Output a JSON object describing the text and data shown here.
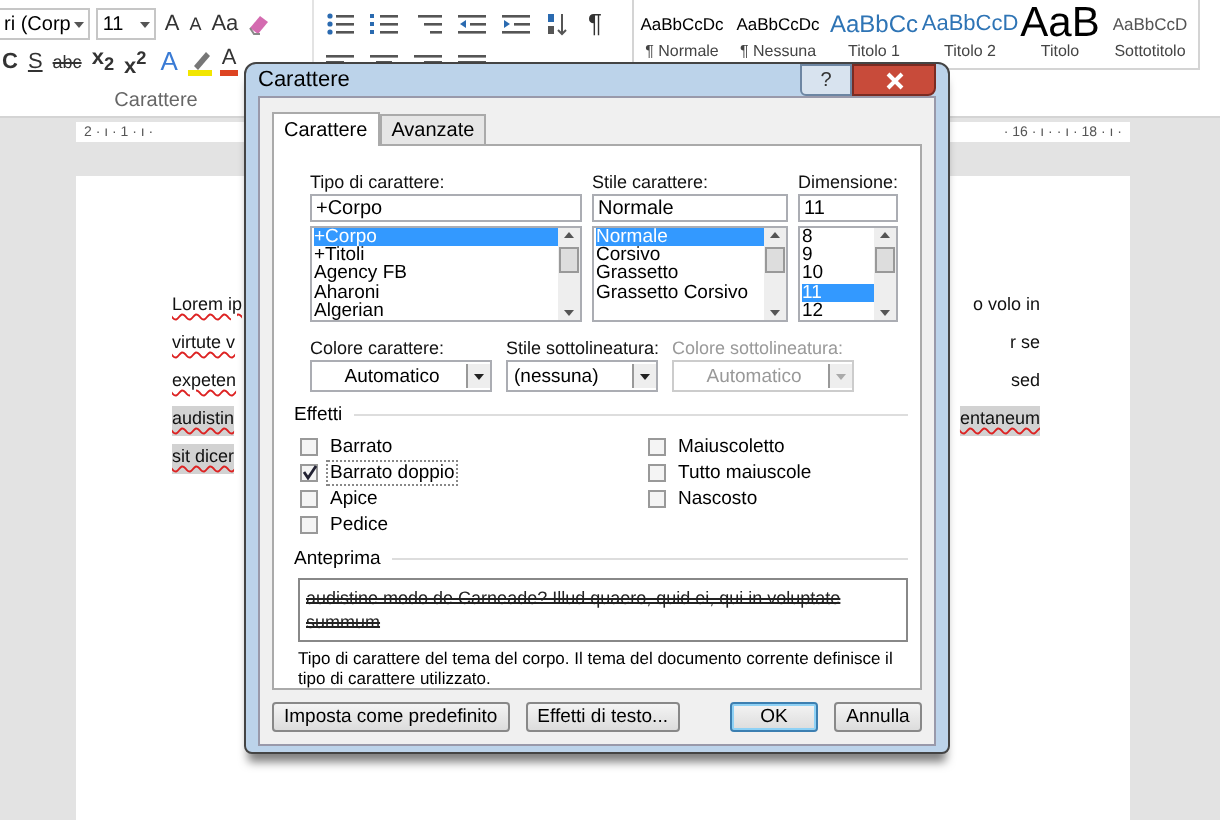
{
  "ribbon": {
    "font_name": "ri (Corp",
    "font_size": "11",
    "size_buttons": [
      "A",
      "A"
    ],
    "change_case": "Aa",
    "format_buttons": [
      {
        "label": "C",
        "kind": "bold"
      },
      {
        "label": "S",
        "kind": "underline"
      },
      {
        "label": "abc",
        "kind": "strike"
      },
      {
        "label": "x$_{2}$",
        "kind": "sub"
      },
      {
        "label": "x$^{2}$",
        "kind": "sup"
      }
    ],
    "effect_buttons": [
      {
        "label": "A",
        "kind": "effects"
      },
      {
        "label": "A",
        "kind": "color"
      }
    ],
    "pilcrow": "¶",
    "group_label": "Carattere"
  },
  "styles": [
    {
      "preview": "AaBbCcDc",
      "name": "¶ Normale",
      "kind": "body"
    },
    {
      "preview": "AaBbCcDc",
      "name": "¶ Nessuna",
      "kind": "body"
    },
    {
      "preview": "AaBbCc",
      "name": "Titolo 1",
      "kind": "heading1"
    },
    {
      "preview": "AaBbCcD",
      "name": "Titolo 2",
      "kind": "heading2"
    },
    {
      "preview": "AaB",
      "name": "Titolo",
      "kind": "title"
    },
    {
      "preview": "AaBbCcD",
      "name": "Sottotitolo",
      "kind": "subtitle"
    }
  ],
  "ruler": {
    "left": "2 · ı · 1 · ı ·",
    "right": "· 16 · ı · · ı · 18 · ı ·"
  },
  "document": {
    "lines": [
      {
        "left": {
          "text": "Lorem ip",
          "misspelled": true
        },
        "right": {
          "text": "o volo in",
          "misspelled": false
        },
        "selected": false
      },
      {
        "left": {
          "text": "virtute v",
          "misspelled": true
        },
        "right": {
          "text": "r se",
          "misspelled": false
        },
        "selected": false
      },
      {
        "left": {
          "text": "expeten",
          "misspelled": true
        },
        "right": {
          "text": "sed",
          "misspelled": false
        },
        "selected": false
      },
      {
        "left": {
          "text": "audistin",
          "misspelled": true
        },
        "right": {
          "text": "entaneum",
          "misspelled": true
        },
        "selected": true
      },
      {
        "left": {
          "text": "sit dicer",
          "misspelled": true
        },
        "selected": true
      }
    ]
  },
  "dialog": {
    "title": "Carattere",
    "help": "?",
    "tabs": [
      {
        "label": "Carattere",
        "selected": true
      },
      {
        "label": "Avanzate",
        "selected": false
      }
    ],
    "lists": [
      {
        "label": "Tipo di carattere:",
        "value": "+Corpo",
        "kind": "font",
        "items": [
          {
            "text": "+Corpo",
            "selected": true
          },
          {
            "text": "+Titoli",
            "selected": false
          },
          {
            "text": "Agency FB",
            "selected": false
          },
          {
            "text": "Aharoni",
            "selected": false
          },
          {
            "text": "Algerian",
            "selected": false
          }
        ]
      },
      {
        "label": "Stile carattere:",
        "value": "Normale",
        "kind": "style",
        "items": [
          {
            "text": "Normale",
            "selected": true
          },
          {
            "text": "Corsivo",
            "selected": false
          },
          {
            "text": "Grassetto",
            "selected": false
          },
          {
            "text": "Grassetto Corsivo",
            "selected": false
          }
        ]
      },
      {
        "label": "Dimensione:",
        "value": "11",
        "kind": "size",
        "items": [
          {
            "text": "8",
            "selected": false
          },
          {
            "text": "9",
            "selected": false
          },
          {
            "text": "10",
            "selected": false
          },
          {
            "text": "11",
            "selected": true
          },
          {
            "text": "12",
            "selected": false
          }
        ]
      }
    ],
    "dropdowns": [
      {
        "label": "Colore carattere:",
        "value": "Automatico",
        "kind": "color",
        "disabled": false
      },
      {
        "label": "Stile sottolineatura:",
        "value": "(nessuna)",
        "kind": "list",
        "disabled": false
      },
      {
        "label": "Colore sottolineatura:",
        "value": "Automatico",
        "kind": "color",
        "disabled": true
      }
    ],
    "effects_title": "Effetti",
    "effects_left": [
      {
        "label": "Barrato",
        "checked": false
      },
      {
        "label": "Barrato doppio",
        "checked": true
      },
      {
        "label": "Apice",
        "checked": false
      },
      {
        "label": "Pedice",
        "checked": false
      }
    ],
    "effects_right": [
      {
        "label": "Maiuscoletto",
        "checked": false
      },
      {
        "label": "Tutto maiuscole",
        "checked": false
      },
      {
        "label": "Nascosto",
        "checked": false
      }
    ],
    "preview_title": "Anteprima",
    "preview_text": "audistine modo de Carneade? Illud quaero, quid ei, qui in voluptate summum",
    "description": "Tipo di carattere del tema del corpo. Il tema del documento corrente definisce il tipo di carattere utilizzato.",
    "buttons_left": [
      {
        "label": "Imposta come predefinito",
        "kind": "normal"
      },
      {
        "label": "Effetti di testo...",
        "kind": "normal"
      }
    ],
    "buttons_right": [
      {
        "label": "OK",
        "kind": "default"
      },
      {
        "label": "Annulla",
        "kind": "normal"
      }
    ]
  }
}
